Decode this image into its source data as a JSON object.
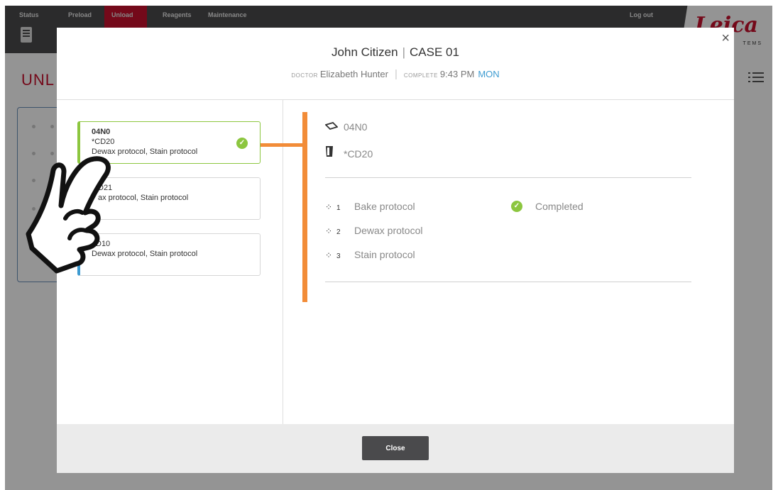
{
  "nav": {
    "status": "Status",
    "preload": "Preload",
    "unload": "Unload",
    "reagents": "Reagents",
    "maintenance": "Maintenance",
    "logout": "Log out",
    "brand": "Leica",
    "brand_sub": "TEMS"
  },
  "page": {
    "title": "UNL"
  },
  "modal": {
    "patient_name": "John Citizen",
    "case_label": "CASE 01",
    "doctor_caption": "doctor",
    "doctor_name": "Elizabeth Hunter",
    "complete_caption": "complete",
    "complete_time": "9:43 PM",
    "complete_day": "MON",
    "close_glyph": "×",
    "close_button": "Close"
  },
  "slides": [
    {
      "id": "04N0",
      "marker": "*CD20",
      "protocols": "Dewax protocol, Stain protocol",
      "state": "selected"
    },
    {
      "id": "",
      "marker": "D21",
      "protocols": "ax protocol, Stain protocol",
      "state": "normal"
    },
    {
      "id": "",
      "marker": "D10",
      "protocols": "Dewax protocol, Stain protocol",
      "state": "blue"
    }
  ],
  "detail": {
    "slide_id": "04N0",
    "marker": "*CD20",
    "protocols": [
      {
        "num": "1",
        "name": "Bake protocol",
        "status": "Completed"
      },
      {
        "num": "2",
        "name": "Dewax protocol",
        "status": ""
      },
      {
        "num": "3",
        "name": "Stain protocol",
        "status": ""
      }
    ]
  },
  "colors": {
    "brand_red": "#c8102e",
    "selected_green": "#8cc63f",
    "link_orange": "#f28c38",
    "accent_blue": "#3d9bd1"
  }
}
